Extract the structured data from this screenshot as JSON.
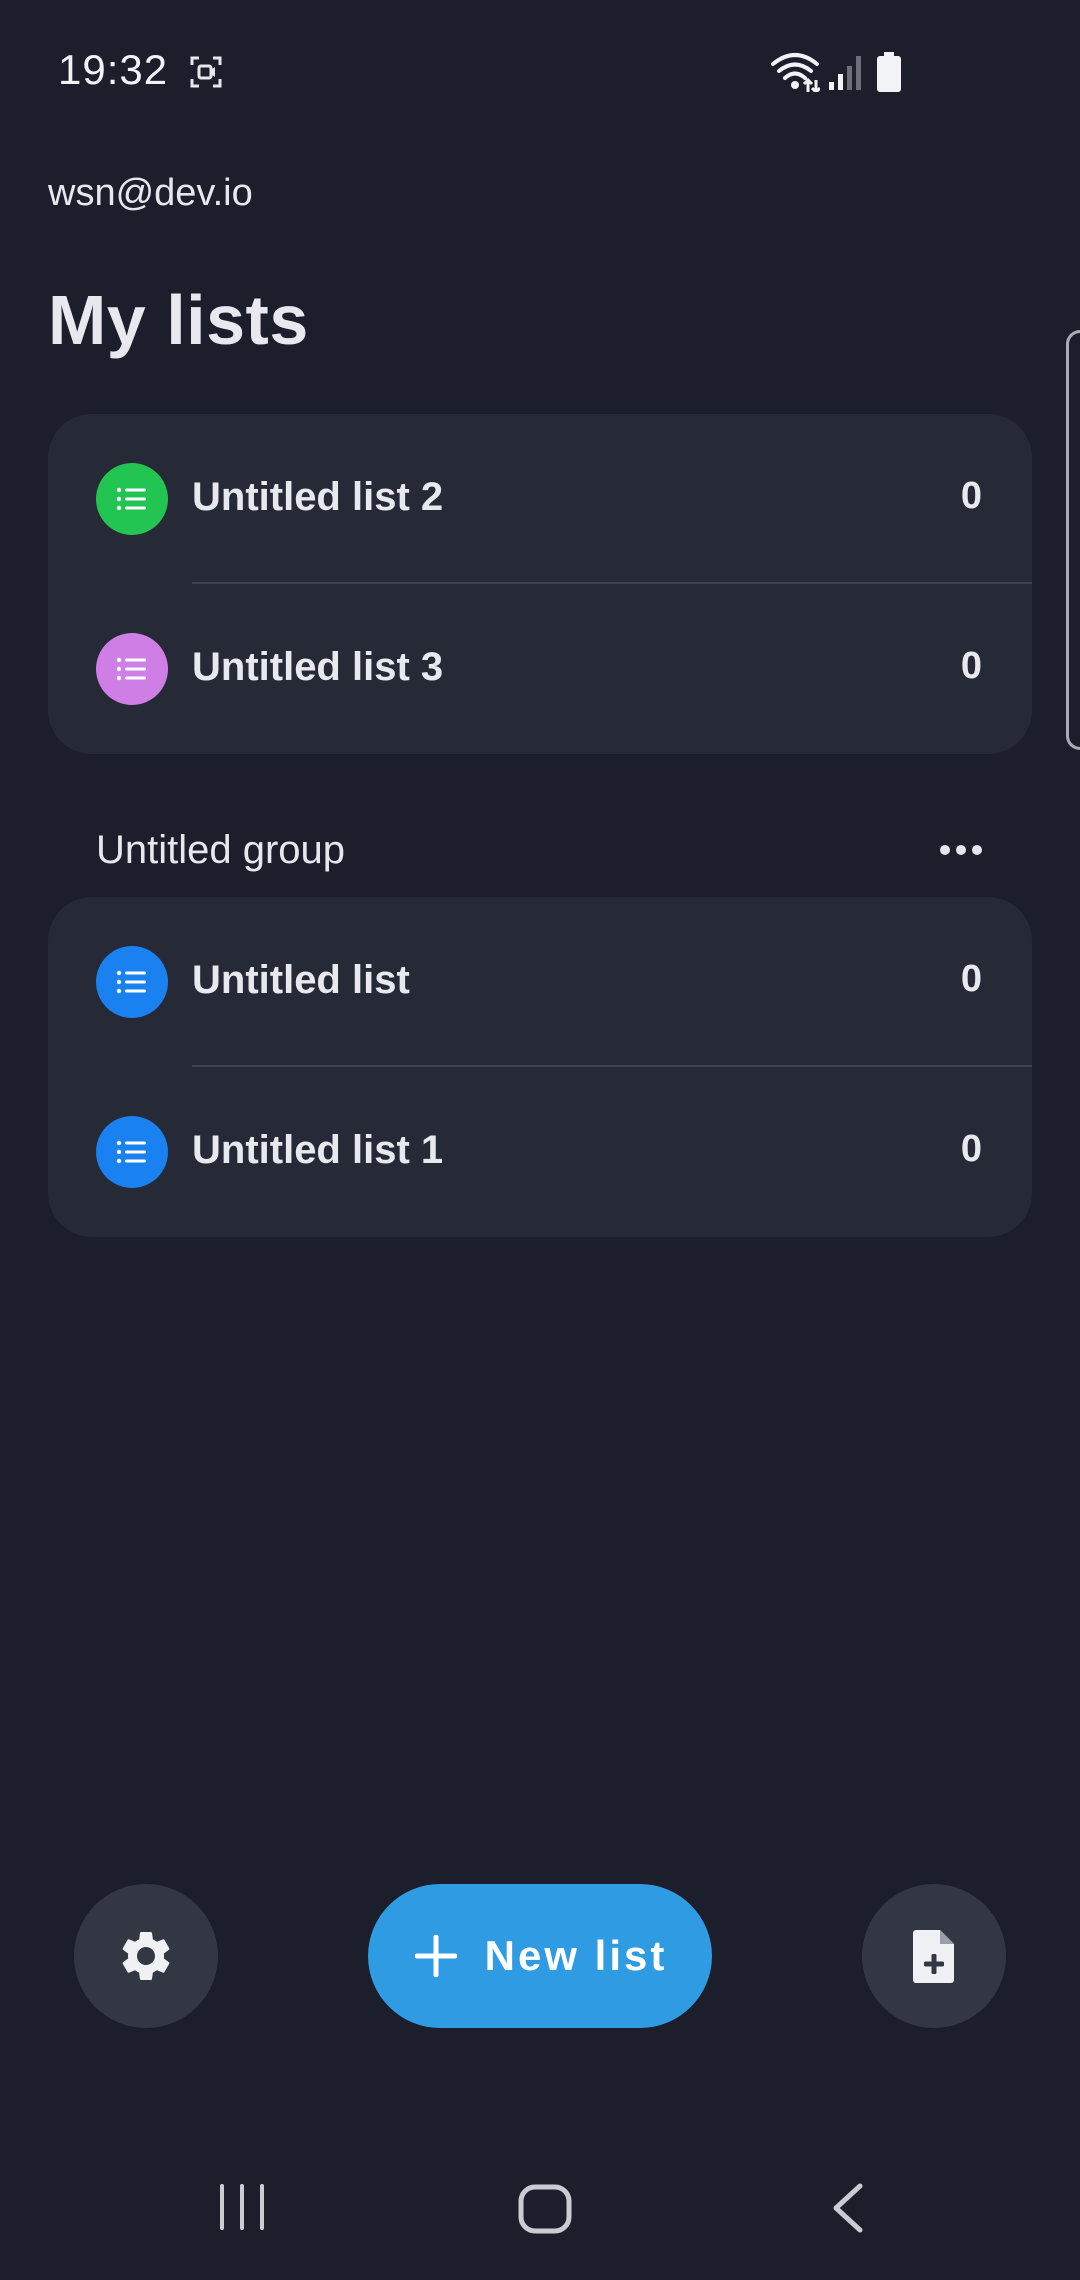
{
  "status_bar": {
    "time": "19:32"
  },
  "account": {
    "email": "wsn@dev.io"
  },
  "page": {
    "title": "My lists"
  },
  "ungrouped_lists": [
    {
      "name": "Untitled list 2",
      "count": "0",
      "color": "#23c552"
    },
    {
      "name": "Untitled list 3",
      "count": "0",
      "color": "#cf7ee6"
    }
  ],
  "group": {
    "name": "Untitled group",
    "lists": [
      {
        "name": "Untitled list",
        "count": "0",
        "color": "#1a82f0"
      },
      {
        "name": "Untitled list 1",
        "count": "0",
        "color": "#1a82f0"
      }
    ]
  },
  "actions": {
    "new_list_label": "New list"
  },
  "colors": {
    "background": "#1c1f2b",
    "card": "#262a37",
    "accent": "#2f9be3"
  }
}
